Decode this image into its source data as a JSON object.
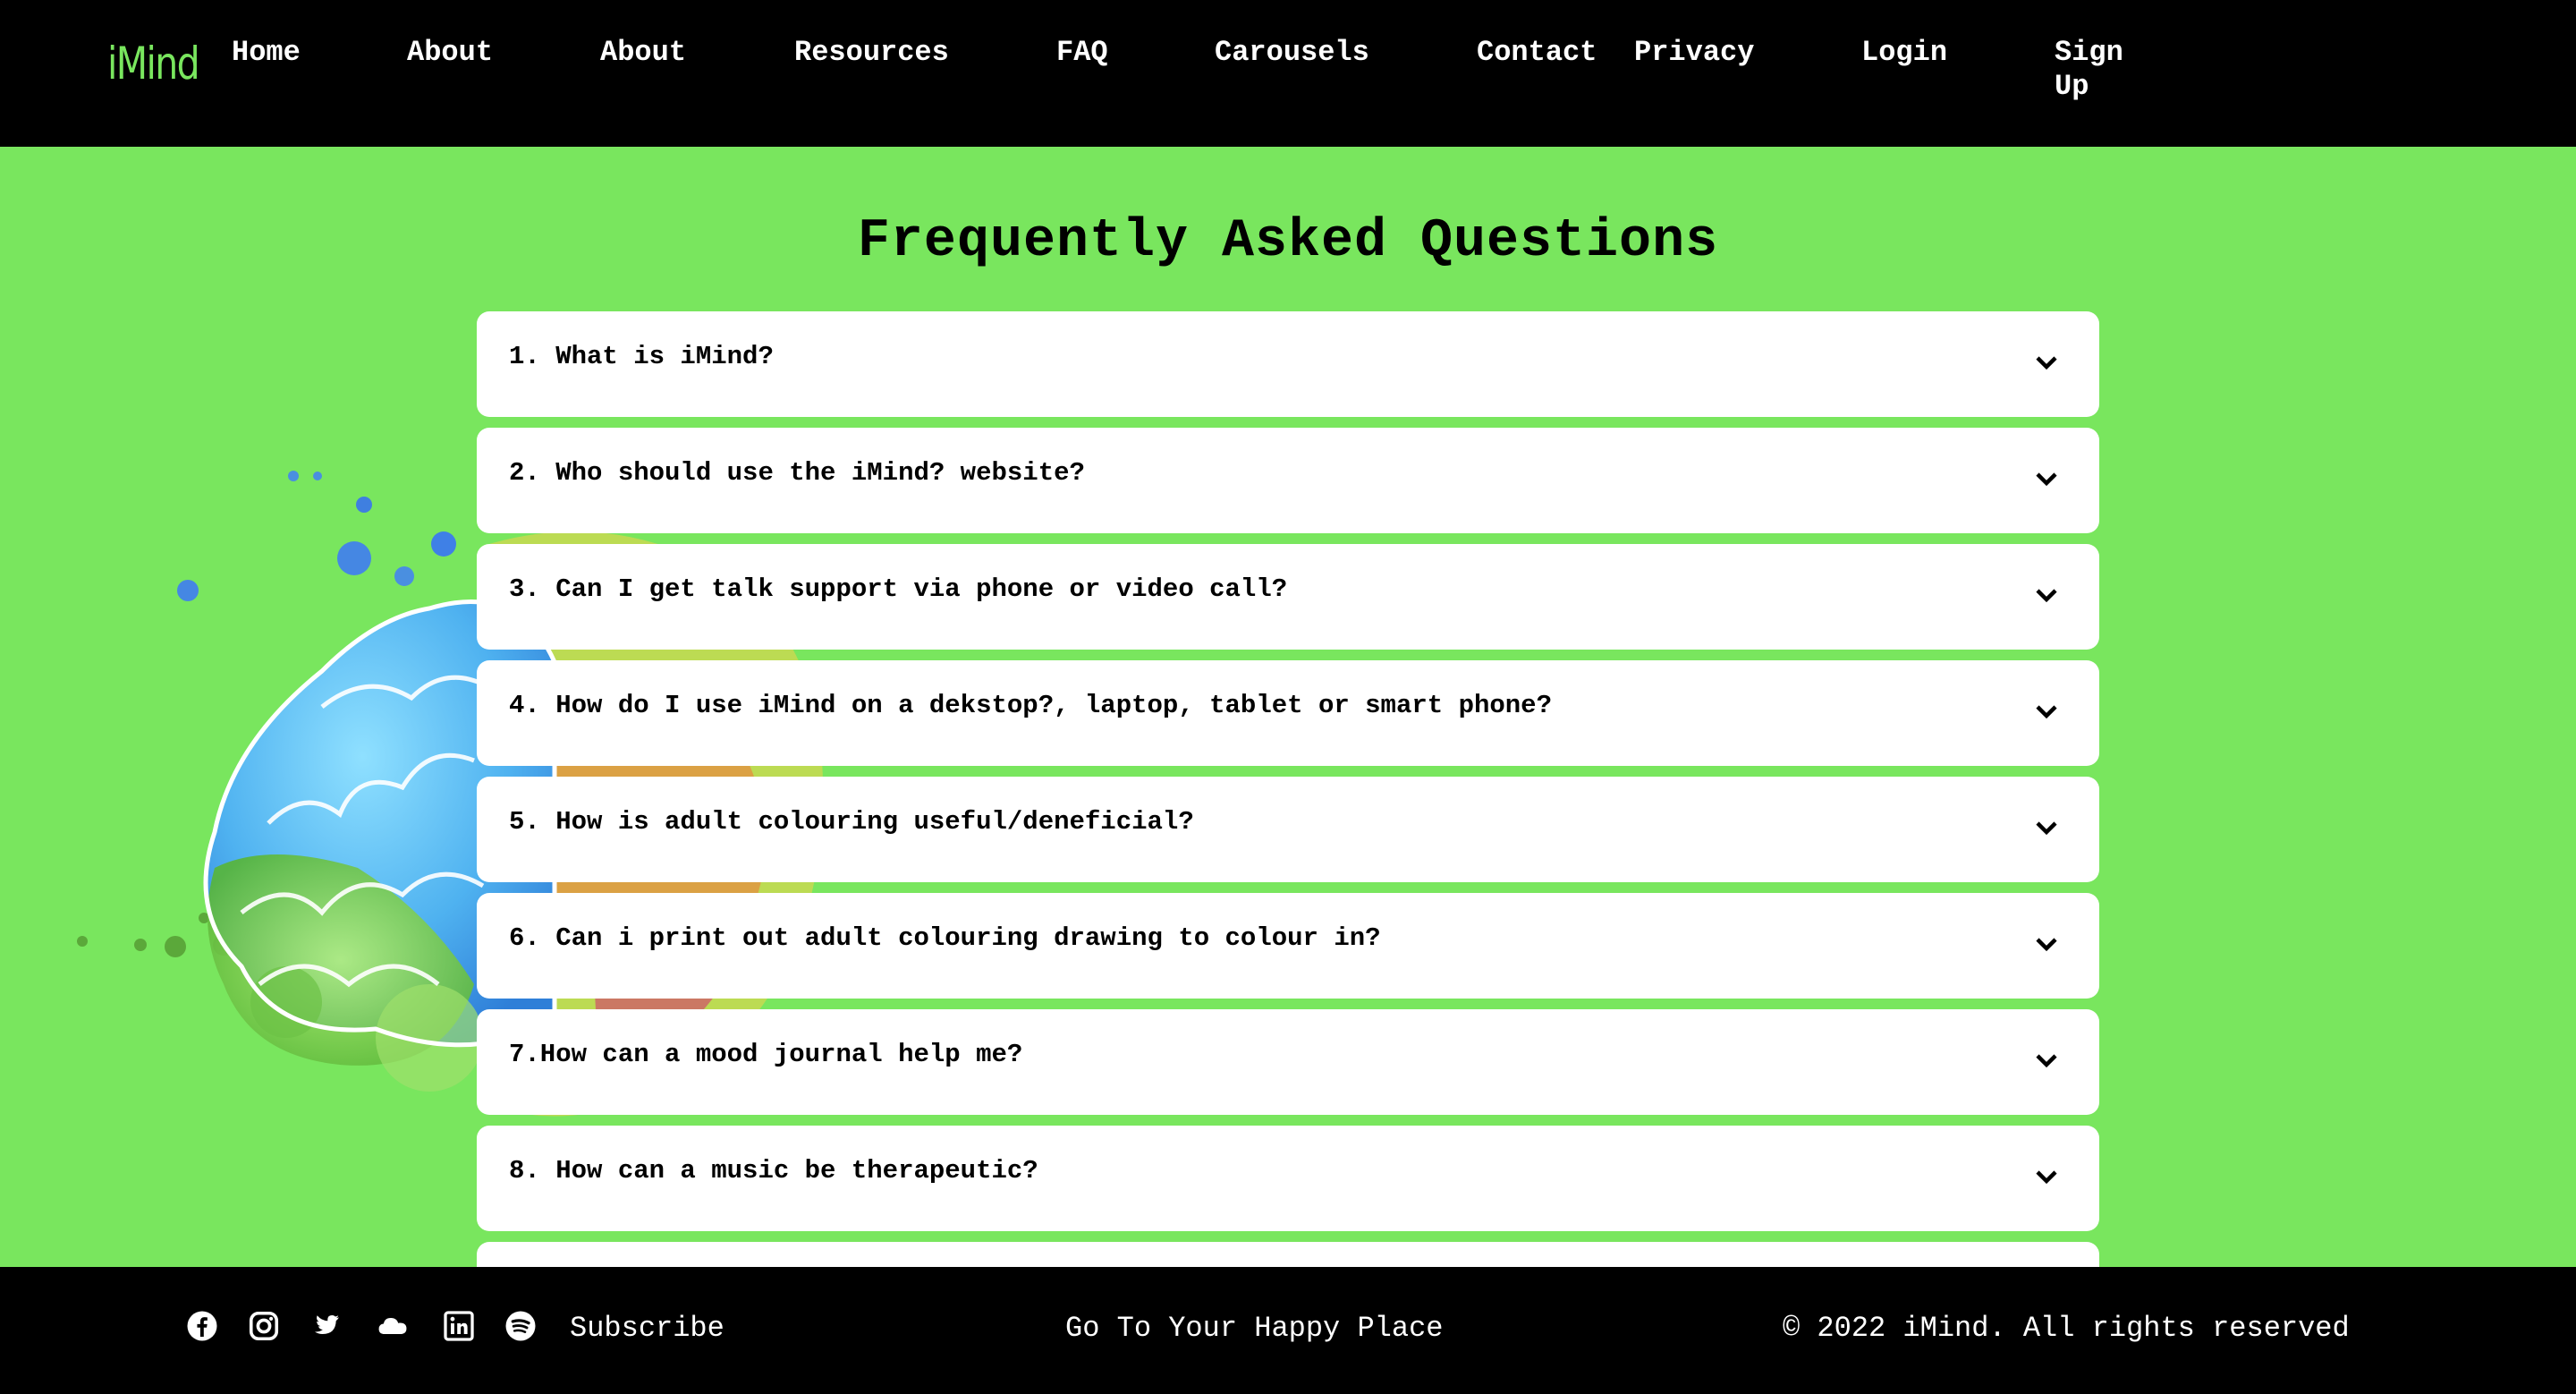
{
  "brand": {
    "logo_text": "iMind",
    "accent_color": "#79e65e"
  },
  "nav": {
    "items": [
      {
        "label": "Home"
      },
      {
        "label": "About"
      },
      {
        "label": "About"
      },
      {
        "label": "Resources"
      },
      {
        "label": "FAQ"
      },
      {
        "label": "Carousels"
      },
      {
        "label": "Contact"
      },
      {
        "label": "Privacy"
      },
      {
        "label": "Login"
      },
      {
        "label": "Sign\nUp"
      }
    ]
  },
  "main": {
    "title": "Frequently Asked Questions",
    "background_color": "#79e65e",
    "illustration": "colorful-brain-illustration",
    "faqs": [
      {
        "question": "1. What is iMind?",
        "expanded": false
      },
      {
        "question": "2. Who should use the iMind? website?",
        "expanded": false
      },
      {
        "question": "3. Can I get talk support via phone or video call?",
        "expanded": false
      },
      {
        "question": "4. How do I use iMind on a dekstop?, laptop, tablet or smart phone?",
        "expanded": false
      },
      {
        "question": "5. How is adult colouring useful/deneficial?",
        "expanded": false
      },
      {
        "question": "6. Can i print out adult colouring drawing to colour in?",
        "expanded": false
      },
      {
        "question": "7.How can a mood journal help me?",
        "expanded": false
      },
      {
        "question": "8. How can a music be therapeutic?",
        "expanded": false
      },
      {
        "question": "",
        "expanded": false
      }
    ]
  },
  "footer": {
    "social_icons": [
      "facebook-icon",
      "instagram-icon",
      "twitter-icon",
      "soundcloud-icon",
      "linkedin-icon",
      "spotify-icon"
    ],
    "subscribe_label": "Subscribe",
    "tagline": "Go To Your Happy Place",
    "copyright": "© 2022 iMind. All rights reserved"
  }
}
